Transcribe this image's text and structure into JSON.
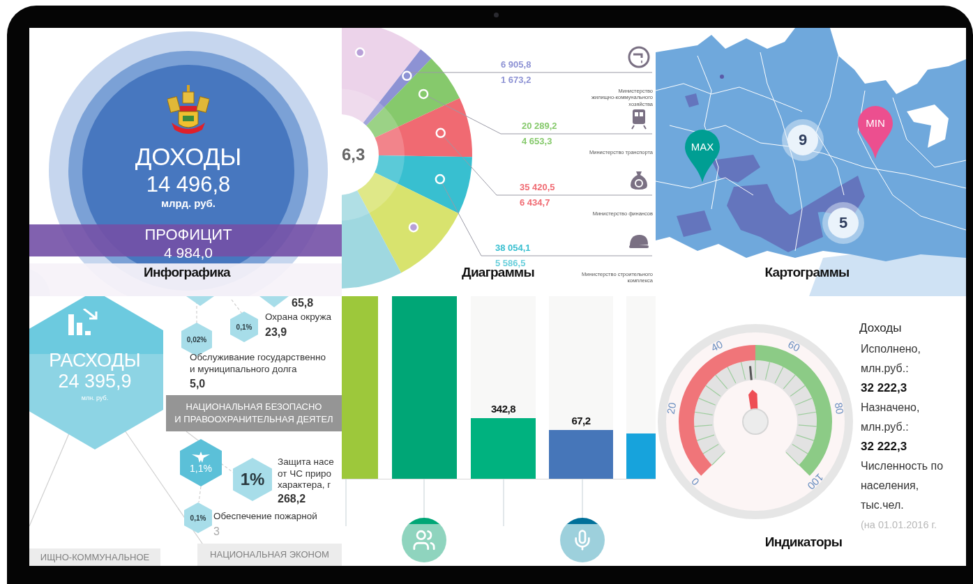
{
  "infographic": {
    "caption": "Инфографика",
    "title": "ДОХОДЫ",
    "value": "14 496,8",
    "unit": "млрд. руб.",
    "surplus_title": "ПРОФИЦИТ",
    "surplus_value": "4 984,0"
  },
  "diagram": {
    "caption": "Диаграммы",
    "center_value": "6,3",
    "ministries": [
      {
        "plan": "6 905,8",
        "fact": "1 673,2",
        "name": "Министерство\nжилищно-коммунального\nхозяйства",
        "color": "#8d92d4"
      },
      {
        "plan": "20 289,2",
        "fact": "4 653,3",
        "name": "Министерство транспорта",
        "color": "#86c96c"
      },
      {
        "plan": "35 420,5",
        "fact": "6 434,7",
        "name": "Министерство финансов",
        "color": "#f06a72"
      },
      {
        "plan": "38 054,1",
        "fact": "5 586,5",
        "name": "Министерство строительного\nкомплекса",
        "color": "#38bfd0"
      }
    ]
  },
  "map": {
    "caption": "Картограммы",
    "pins": [
      {
        "label": "MAX",
        "color": "#009e93"
      },
      {
        "label": "MIN",
        "color": "#ec4f8f"
      }
    ],
    "clusters": [
      "9",
      "5"
    ]
  },
  "expenses": {
    "title": "РАСХОДЫ",
    "value": "24 395,9",
    "unit": "млн. руб.",
    "items": [
      {
        "kind": "amount",
        "text": "65,8"
      },
      {
        "kind": "hex",
        "text": "0,1%"
      },
      {
        "kind": "label",
        "text": "Охрана окружа"
      },
      {
        "kind": "amount",
        "text": "23,9"
      },
      {
        "kind": "hex",
        "text": "0,02%"
      },
      {
        "kind": "label",
        "text": "Обслуживание государственно\nи муниципального долга"
      },
      {
        "kind": "amount",
        "text": "5,0"
      },
      {
        "kind": "banner",
        "text": "НАЦИОНАЛЬНАЯ БЕЗОПАСНО\nИ ПРАВООХРАНИТЕЛЬНАЯ ДЕЯТЕЛ"
      },
      {
        "kind": "hex_icon",
        "text": "1,1%"
      },
      {
        "kind": "hex_large",
        "text": "1%"
      },
      {
        "kind": "label",
        "text": "Защита насе\nот ЧС приро\nхарактера, г"
      },
      {
        "kind": "amount",
        "text": "268,2"
      },
      {
        "kind": "hex",
        "text": "0,1%"
      },
      {
        "kind": "label",
        "text": "Обеспечение пожарной"
      },
      {
        "kind": "faint",
        "text": "3"
      },
      {
        "kind": "faded_banner",
        "text": "ИЩНО-КОММУНАЛЬНОЕ"
      },
      {
        "kind": "faded_banner",
        "text": "НАЦИОНАЛЬНАЯ ЭКОНОМ"
      }
    ]
  },
  "bars": {
    "items": [
      {
        "color": "#9dc83b"
      },
      {
        "color": "#00a676"
      },
      {
        "color": "#00b27f",
        "value": "342,8"
      },
      {
        "color": "#4676b9",
        "value": "67,2"
      },
      {
        "color": "#17a3dc"
      }
    ]
  },
  "indicators": {
    "caption": "Индикаторы",
    "level": 0.48,
    "ticks": [
      "0",
      "20",
      "40",
      "60",
      "80",
      "100"
    ],
    "title": "Доходы",
    "rows": [
      {
        "kind": "label",
        "text": "Исполнено,\nмлн.руб.:"
      },
      {
        "kind": "value",
        "text": "32 222,3"
      },
      {
        "kind": "label",
        "text": "Назначено,\nмлн.руб.:"
      },
      {
        "kind": "value",
        "text": "32 222,3"
      },
      {
        "kind": "label",
        "text": "Численность по\nнаселения,\nтыс.чел."
      },
      {
        "kind": "note",
        "text": "(на 01.01.2016 г."
      }
    ]
  }
}
